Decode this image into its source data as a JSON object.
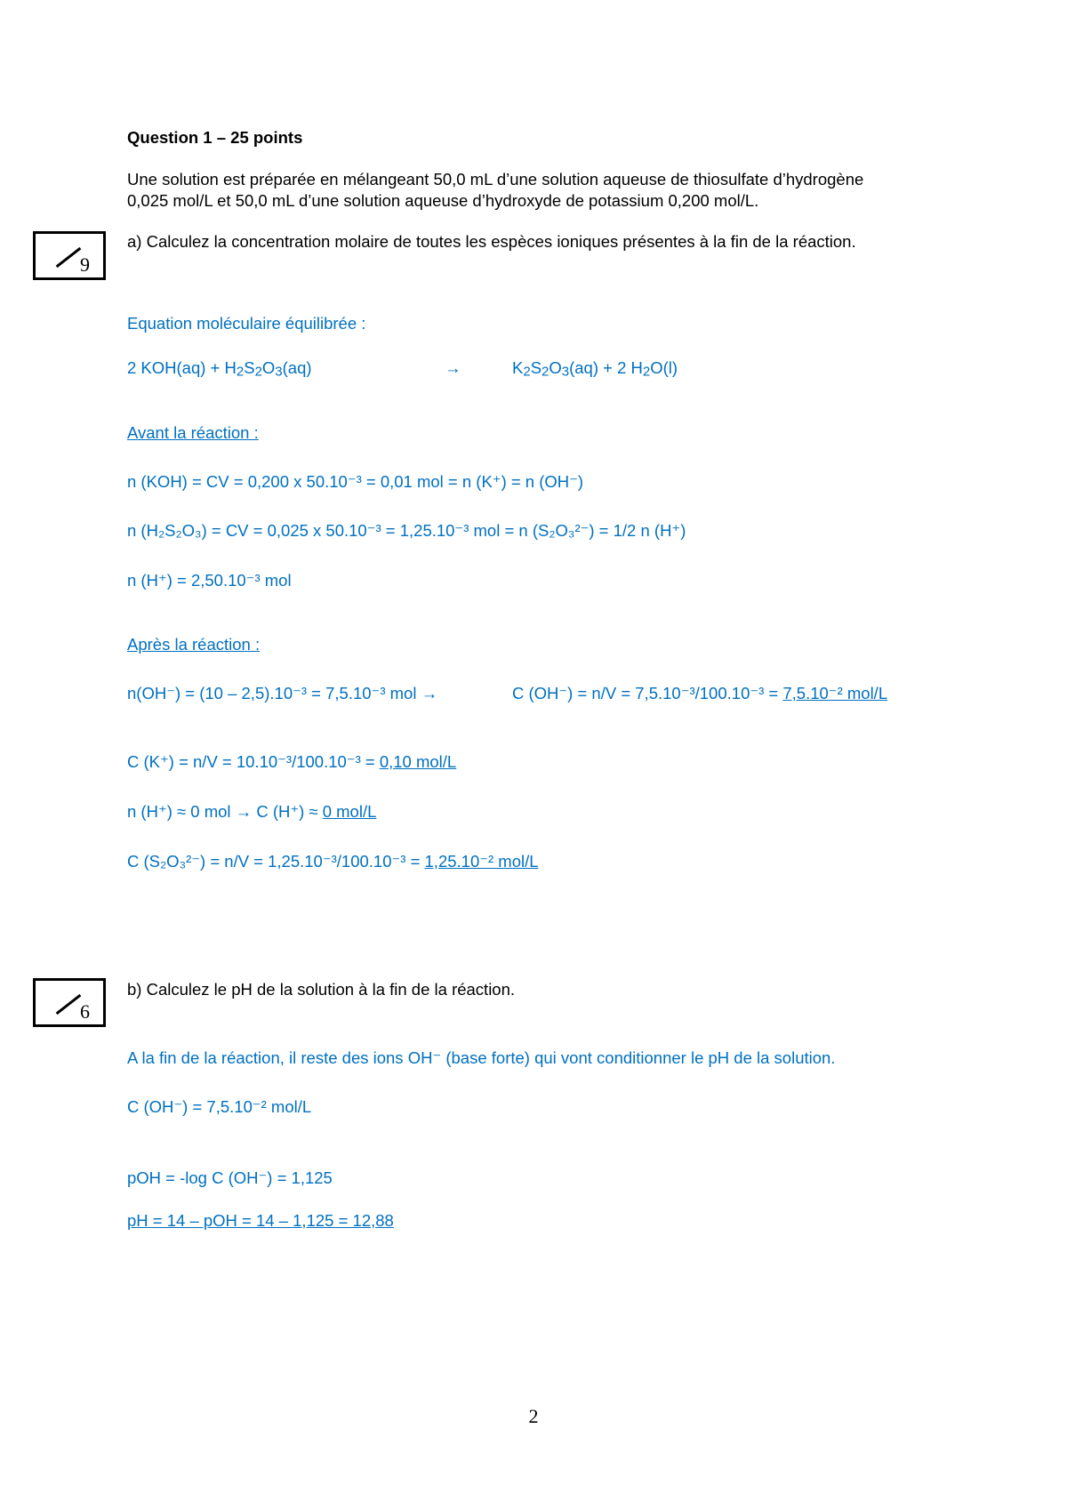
{
  "question": {
    "title": "Question 1 – 25 points",
    "intro_line1": "Une solution est préparée en mélangeant 50,0 mL d’une solution aqueuse de thiosulfate d’hydrogène",
    "intro_line2": "0,025 mol/L et 50,0 mL d’une solution aqueuse d’hydroxyde de potassium 0,200 mol/L."
  },
  "part_a": {
    "score": "9",
    "prompt": "a) Calculez la concentration molaire de toutes les espèces ioniques présentes à la fin de la réaction.",
    "equation_heading": "Equation moléculaire équilibrée :",
    "equation_left": [
      "2 KOH(aq) + H",
      "2",
      "S",
      "2",
      "O",
      "3",
      "(aq)"
    ],
    "equation_arrow": "→",
    "equation_right": [
      "K",
      "2",
      "S",
      "2",
      "O",
      "3",
      "(aq) + 2 H",
      "2",
      "O(l)"
    ],
    "before_heading": "Avant la réaction :",
    "before_lines": {
      "koh": "n (KOH) = CV = 0,200 x 50.10⁻³ = 0,01 mol = n (K⁺) = n (OH⁻)",
      "h2s2o3": "n (H₂S₂O₃) = CV = 0,025 x 50.10⁻³ = 1,25.10⁻³ mol = n (S₂O₃²⁻) = 1/2 n (H⁺)",
      "h_plus": "n (H⁺) = 2,50.10⁻³ mol"
    },
    "after_heading": "Après la réaction :",
    "after_lines": {
      "oh_moles": "n(OH⁻) = (10 – 2,5).10⁻³ =  7,5.10⁻³ mol →",
      "oh_conc": "C (OH⁻) = n/V = 7,5.10⁻³/100.10⁻³ = 7,5.10⁻² mol/L",
      "oh_conc_result": "7,5.10⁻² mol/L",
      "k_conc": "C (K⁺) = n/V = 10.10⁻³/100.10⁻³ = 0,10 mol/L",
      "k_conc_result": "0,10 mol/L",
      "h_conc": "n (H⁺) ≈ 0 mol  → C (H⁺) ≈ 0 mol/L",
      "h_conc_result": "0 mol/L",
      "s2o3_conc": "C (S₂O₃²⁻) = n/V = 1,25.10⁻³/100.10⁻³ = 1,25.10⁻² mol/L",
      "s2o3_conc_result": "1,25.10⁻² mol/L"
    }
  },
  "part_b": {
    "score": "6",
    "prompt": "b) Calculez le pH de la solution à la fin de la réaction.",
    "explanation": "A la fin de la réaction, il reste des ions OH⁻ (base forte) qui vont conditionner le pH de la solution.",
    "c_oh": "C (OH⁻) = 7,5.10⁻² mol/L",
    "poh": "pOH = -log C (OH⁻) = 1,125",
    "ph": "pH = 14 – pOH = 14 – 1,125 = 12,88"
  },
  "page_number": "2",
  "colors": {
    "answer_blue": "#0070C0",
    "text_black": "#000000"
  }
}
